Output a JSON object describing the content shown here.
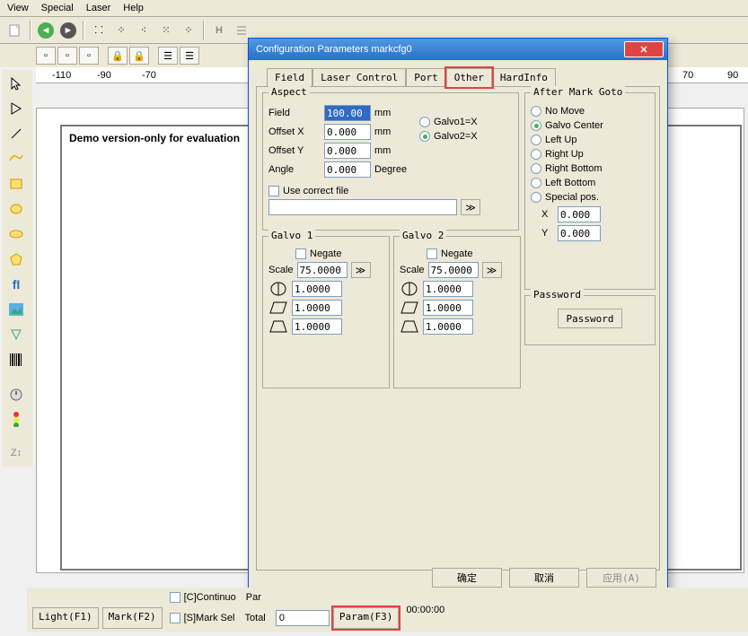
{
  "menu": {
    "view": "View",
    "special": "Special",
    "laser": "Laser",
    "help": "Help"
  },
  "dialog": {
    "title": "Configuration Parameters markcfg0",
    "tabs": {
      "field": "Field",
      "laser_control": "Laser Control",
      "port": "Port",
      "other": "Other",
      "hardinfo": "HardInfo"
    },
    "aspect": {
      "legend": "Aspect",
      "field_label": "Field",
      "field_value": "100.00",
      "field_unit": "mm",
      "offsetx_label": "Offset X",
      "offsetx_value": "0.000",
      "offsetx_unit": "mm",
      "offsety_label": "Offset Y",
      "offsety_value": "0.000",
      "offsety_unit": "mm",
      "angle_label": "Angle",
      "angle_value": "0.000",
      "angle_unit": "Degree",
      "galvo1_opt": "Galvo1=X",
      "galvo2_opt": "Galvo2=X",
      "use_correct_file": "Use correct file"
    },
    "galvo1": {
      "legend": "Galvo 1",
      "negate": "Negate",
      "scale_label": "Scale",
      "scale_value": "75.0000",
      "v1": "1.0000",
      "v2": "1.0000",
      "v3": "1.0000"
    },
    "galvo2": {
      "legend": "Galvo 2",
      "negate": "Negate",
      "scale_label": "Scale",
      "scale_value": "75.0000",
      "v1": "1.0000",
      "v2": "1.0000",
      "v3": "1.0000"
    },
    "after_mark": {
      "legend": "After Mark Goto",
      "no_move": "No Move",
      "galvo_center": "Galvo Center",
      "left_up": "Left Up",
      "right_up": "Right Up",
      "right_bottom": "Right Bottom",
      "left_bottom": "Left Bottom",
      "special": "Special pos.",
      "x_label": "X",
      "x_value": "0.000",
      "y_label": "Y",
      "y_value": "0.000"
    },
    "password": {
      "legend": "Password",
      "button": "Password"
    },
    "buttons": {
      "ok": "确定",
      "cancel": "取消",
      "apply": "应用(A)"
    }
  },
  "canvas": {
    "demo_text": "Demo version-only for evaluation"
  },
  "ruler": {
    "m110": "-110",
    "m90": "-90",
    "m70": "-70",
    "p70": "70",
    "p90": "90"
  },
  "bottom": {
    "light": "Light(F1)",
    "mark": "Mark(F2)",
    "continuo": "[C]Continuo",
    "par": "Par",
    "marksel": "[S]Mark Sel",
    "total": "Total",
    "total_value": "0",
    "param": "Param(F3)",
    "time": "00:00:00"
  }
}
